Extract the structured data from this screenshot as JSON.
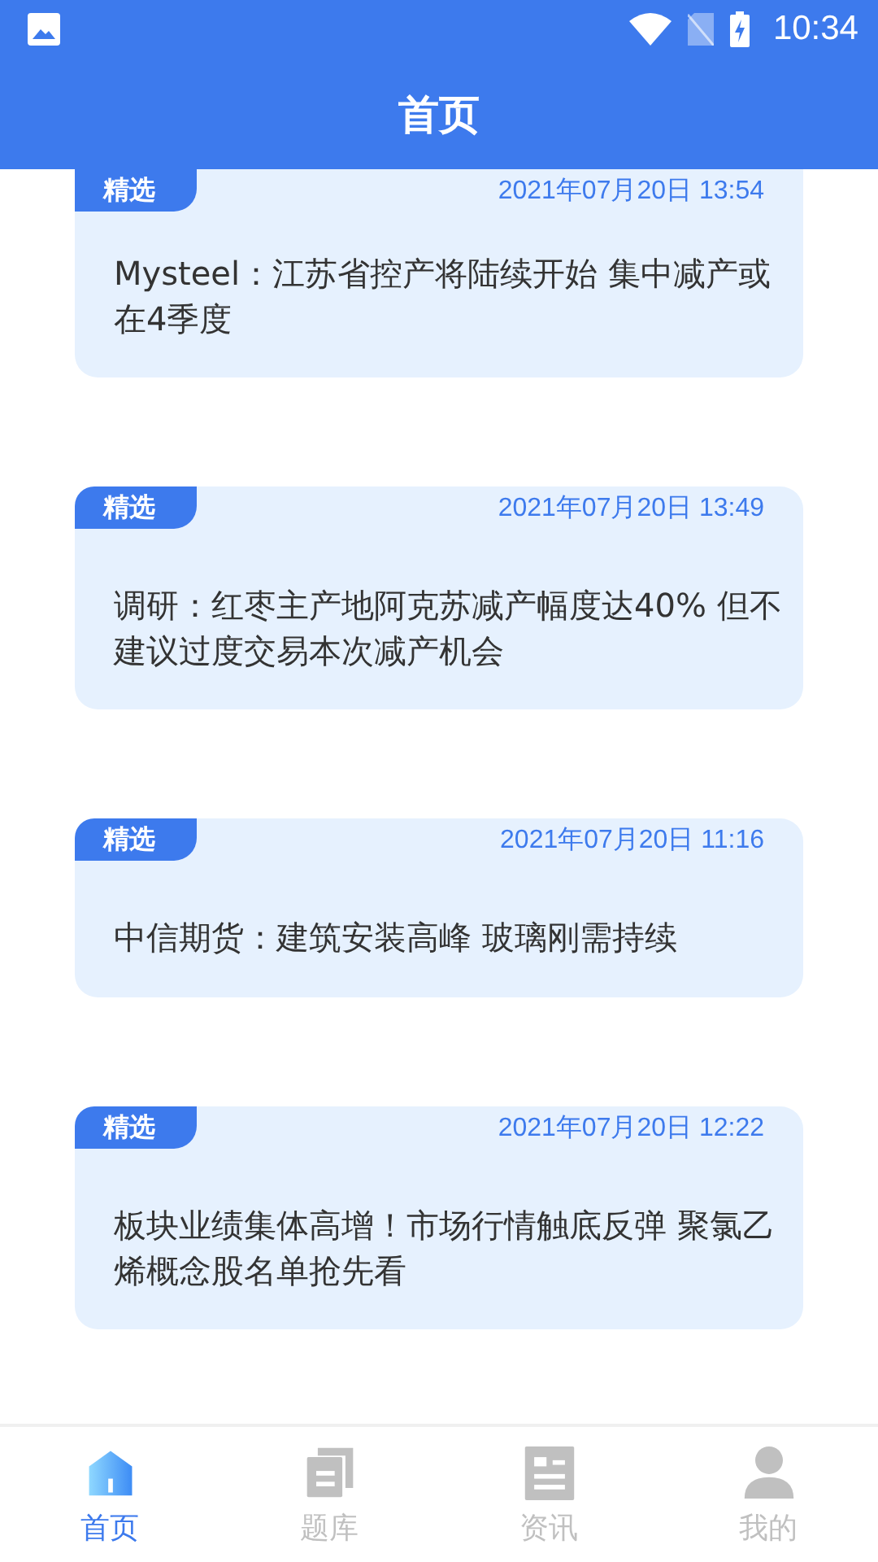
{
  "status_bar": {
    "time": "10:34"
  },
  "header": {
    "title": "首页"
  },
  "articles": [
    {
      "tag": "精选",
      "date": "2021年07月20日 13:54",
      "title": "Mysteel：江苏省控产将陆续开始 集中减产或在4季度"
    },
    {
      "tag": "精选",
      "date": "2021年07月20日 13:49",
      "title": "调研：红枣主产地阿克苏减产幅度达40% 但不建议过度交易本次减产机会"
    },
    {
      "tag": "精选",
      "date": "2021年07月20日 11:16",
      "title": "中信期货：建筑安装高峰 玻璃刚需持续"
    },
    {
      "tag": "精选",
      "date": "2021年07月20日 12:22",
      "title": "板块业绩集体高增！市场行情触底反弹 聚氯乙烯概念股名单抢先看"
    }
  ],
  "tab_bar": [
    {
      "label": "首页",
      "kind": "home",
      "selected": true
    },
    {
      "label": "题库",
      "kind": "questions",
      "selected": false
    },
    {
      "label": "资讯",
      "kind": "news",
      "selected": false
    },
    {
      "label": "我的",
      "kind": "profile",
      "selected": false
    }
  ]
}
